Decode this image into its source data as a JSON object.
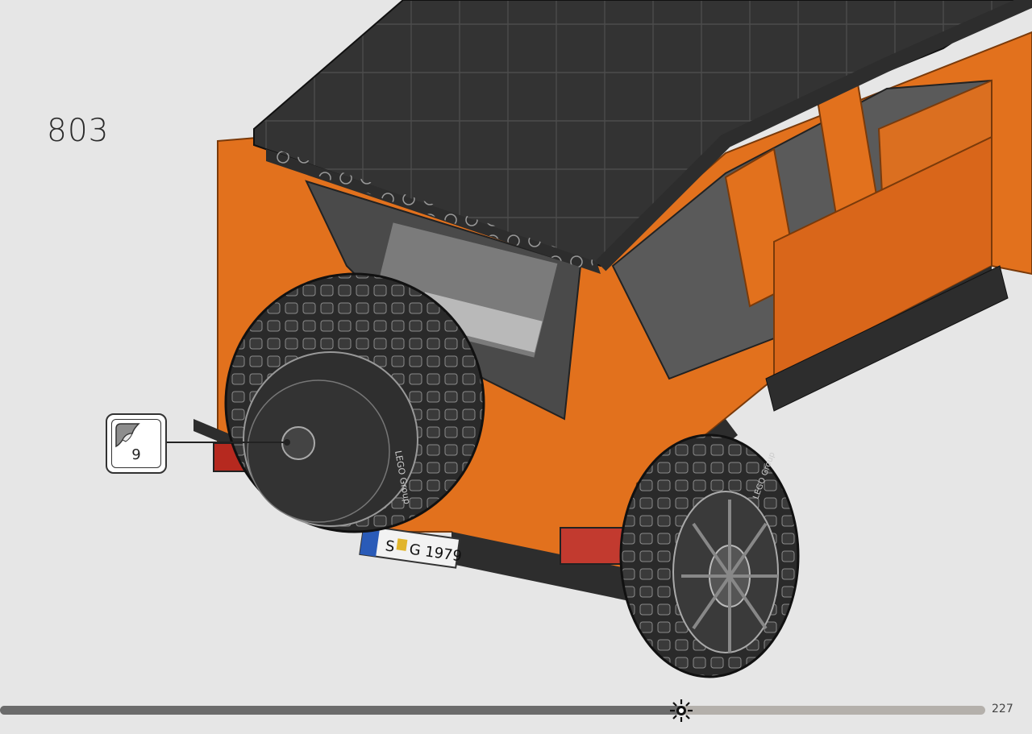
{
  "step": {
    "number": "803"
  },
  "callout": {
    "count": "9",
    "icon": "sticker-icon"
  },
  "vehicle": {
    "plate_prefix": "S",
    "plate_text": "G 1979",
    "tire_brand": "LEGO Group",
    "body_color": "#e2711d",
    "frame_color": "#2d2d2d"
  },
  "footer": {
    "page_number": "227",
    "progress_fraction": 0.69,
    "progress_icon": "sun-gear-icon"
  }
}
